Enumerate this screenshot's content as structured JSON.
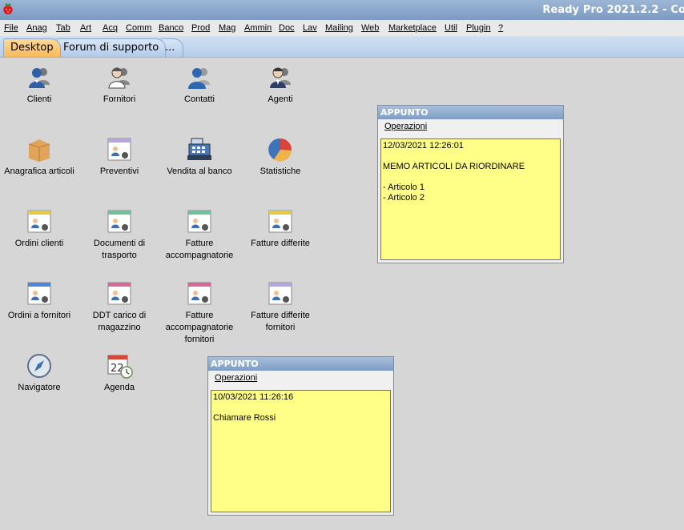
{
  "window": {
    "title": "Ready Pro 2021.2.2 - Co"
  },
  "menu": [
    {
      "label": "File"
    },
    {
      "label": "Anag"
    },
    {
      "label": "Tab"
    },
    {
      "label": "Art"
    },
    {
      "label": "Acq"
    },
    {
      "label": "Comm"
    },
    {
      "label": "Banco"
    },
    {
      "label": "Prod"
    },
    {
      "label": "Mag"
    },
    {
      "label": "Ammin"
    },
    {
      "label": "Doc"
    },
    {
      "label": "Lav"
    },
    {
      "label": "Mailing"
    },
    {
      "label": "Web"
    },
    {
      "label": "Marketplace"
    },
    {
      "label": "Util"
    },
    {
      "label": "Plugin"
    },
    {
      "label": "?"
    }
  ],
  "tabs": [
    {
      "label": "Desktop",
      "active": true
    },
    {
      "label": "Forum di supporto",
      "active": false
    },
    {
      "label": "...",
      "active": false
    }
  ],
  "desktop": [
    {
      "label": "Clienti",
      "icon": "people-icon"
    },
    {
      "label": "Fornitori",
      "icon": "suppliers-icon"
    },
    {
      "label": "Contatti",
      "icon": "contacts-icon"
    },
    {
      "label": "Agenti",
      "icon": "agents-icon"
    },
    {
      "label": "Anagrafica articoli",
      "icon": "box-icon"
    },
    {
      "label": "Preventivi",
      "icon": "document-purple-icon"
    },
    {
      "label": "Vendita al banco",
      "icon": "cash-register-icon"
    },
    {
      "label": "Statistiche",
      "icon": "pie-chart-icon"
    },
    {
      "label": "Ordini clienti",
      "icon": "document-yellow-icon"
    },
    {
      "label": "Documenti di trasporto",
      "icon": "document-green-icon"
    },
    {
      "label": "Fatture accompagnatorie",
      "icon": "document-green-icon"
    },
    {
      "label": "Fatture differite",
      "icon": "document-yellow-icon"
    },
    {
      "label": "Ordini a fornitori",
      "icon": "document-blue-icon"
    },
    {
      "label": "DDT carico di magazzino",
      "icon": "document-pink-icon"
    },
    {
      "label": "Fatture accompagnatorie fornitori",
      "icon": "document-pink-icon"
    },
    {
      "label": "Fatture differite fornitori",
      "icon": "document-lilac-icon"
    },
    {
      "label": "Navigatore",
      "icon": "compass-icon"
    },
    {
      "label": "Agenda",
      "icon": "calendar-clock-icon"
    }
  ],
  "notes": [
    {
      "title": "APPUNTO",
      "menu_label": "Operazioni",
      "text": "12/03/2021 12:26:01\n\nMEMO ARTICOLI DA RIORDINARE\n\n- Articolo 1\n- Articolo 2"
    },
    {
      "title": "APPUNTO",
      "menu_label": "Operazioni",
      "text": "10/03/2021 11:26:16\n\nChiamare Rossi"
    }
  ],
  "colors": {
    "titlebar": "#7c9ac2",
    "active_tab": "#f7b95a",
    "note_body": "#ffff88",
    "background": "#d6d6d6",
    "doc_yellow": "#e7c940",
    "doc_green": "#6cc29a",
    "doc_blue": "#4f86d9",
    "doc_pink": "#d9679a",
    "doc_lilac": "#b4a7e0",
    "doc_purple": "#b9a4e2"
  }
}
